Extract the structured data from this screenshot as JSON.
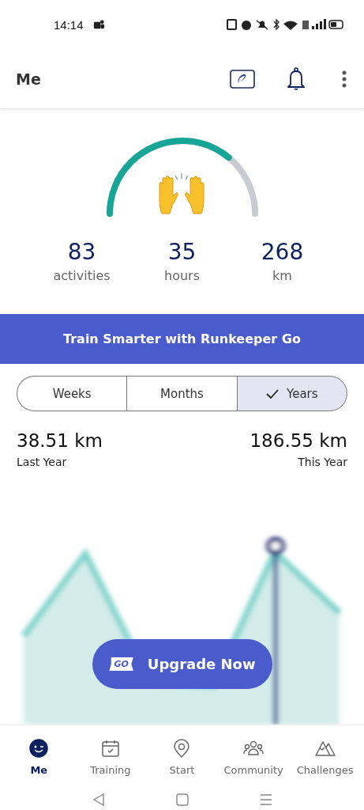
{
  "status_bar": {
    "time": "14:14"
  },
  "header": {
    "title": "Me"
  },
  "stats": [
    {
      "value": "83",
      "label": "activities"
    },
    {
      "value": "35",
      "label": "hours"
    },
    {
      "value": "268",
      "label": "km"
    }
  ],
  "banner": {
    "text": "Train Smarter with Runkeeper Go"
  },
  "period_tabs": [
    {
      "label": "Weeks",
      "selected": false
    },
    {
      "label": "Months",
      "selected": false
    },
    {
      "label": "Years",
      "selected": true
    }
  ],
  "comparison": [
    {
      "value": "38.51 km",
      "label": "Last Year"
    },
    {
      "value": "186.55 km",
      "label": "This Year"
    }
  ],
  "upgrade_button": {
    "badge": "GO",
    "label": "Upgrade Now"
  },
  "nav": [
    {
      "label": "Me",
      "selected": true
    },
    {
      "label": "Training",
      "selected": false
    },
    {
      "label": "Start",
      "selected": false
    },
    {
      "label": "Community",
      "selected": false
    },
    {
      "label": "Challenges",
      "selected": false
    }
  ]
}
